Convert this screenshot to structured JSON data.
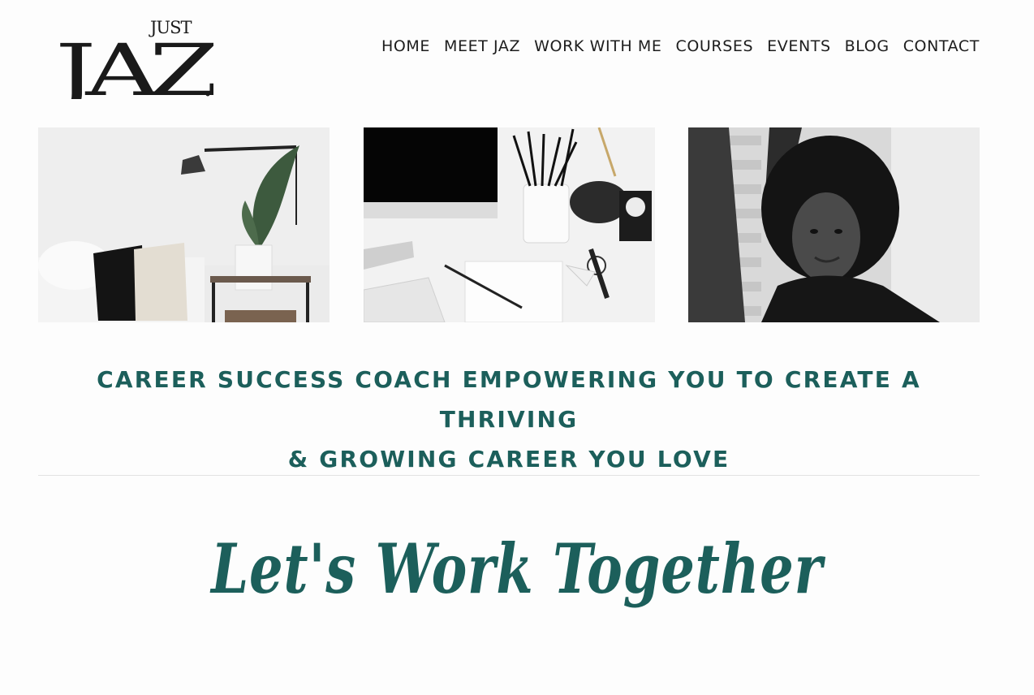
{
  "brand": {
    "logo_small": "JUST",
    "logo_large": "JAZ",
    "logo_name": "just-jaz-logo"
  },
  "nav": {
    "items": [
      {
        "label": "HOME"
      },
      {
        "label": "MEET JAZ"
      },
      {
        "label": "WORK WITH ME"
      },
      {
        "label": "COURSES"
      },
      {
        "label": "EVENTS"
      },
      {
        "label": "BLOG"
      },
      {
        "label": "CONTACT"
      }
    ]
  },
  "gallery": {
    "images": [
      {
        "name": "living-room-photo"
      },
      {
        "name": "desk-workspace-photo"
      },
      {
        "name": "portrait-photo"
      }
    ]
  },
  "hero": {
    "tagline_line1": "CAREER SUCCESS COACH EMPOWERING YOU TO CREATE A THRIVING",
    "tagline_line2": "& GROWING CAREER YOU LOVE",
    "script_heading": "Let's Work Together"
  },
  "colors": {
    "accent": "#1c5f5b",
    "text": "#1d1d1d",
    "background": "#fdfdfd",
    "divider": "#e2e2e2"
  }
}
